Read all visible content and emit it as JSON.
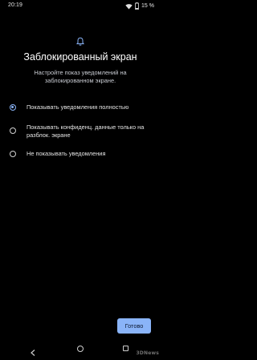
{
  "status_bar": {
    "time": "20:19",
    "battery_text": "15 %"
  },
  "header": {
    "icon": "bell-icon",
    "title": "Заблокированный экран",
    "subtitle": "Настройте показ уведомлений на заблокированном экране."
  },
  "options": [
    {
      "label": "Показывать уведомления полностью",
      "checked": true
    },
    {
      "label": "Показывать конфиденц. данные только на разблок. экране",
      "checked": false
    },
    {
      "label": "Не показывать уведомления",
      "checked": false
    }
  ],
  "actions": {
    "done_label": "Готово"
  },
  "watermark": "3DNews",
  "colors": {
    "accent": "#8ab4f8",
    "background": "#000000",
    "text": "#ffffff"
  }
}
